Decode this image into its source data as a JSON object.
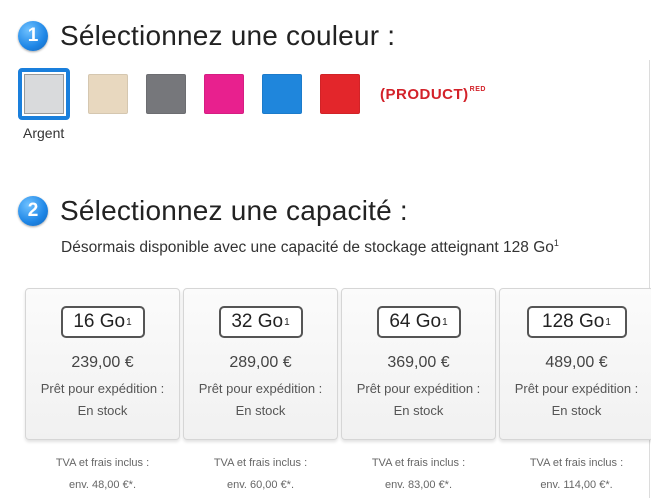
{
  "step1": {
    "number": "1",
    "title": "Sélectionnez une couleur :"
  },
  "colors": [
    {
      "name": "silver",
      "hex": "#d9dadc",
      "selected": true
    },
    {
      "name": "gold",
      "hex": "#e8d8bf",
      "selected": false
    },
    {
      "name": "space-gray",
      "hex": "#76777b",
      "selected": false
    },
    {
      "name": "pink",
      "hex": "#e8208e",
      "selected": false
    },
    {
      "name": "blue",
      "hex": "#1f86dc",
      "selected": false
    },
    {
      "name": "red",
      "hex": "#e3262b",
      "selected": false
    }
  ],
  "product_red": {
    "label": "(PRODUCT)",
    "sup": "RED"
  },
  "selected_color_label": "Argent",
  "step2": {
    "number": "2",
    "title": "Sélectionnez une capacité :"
  },
  "subtitle": {
    "text": "Désormais disponible avec une capacité de stockage atteignant 128 Go",
    "sup": "1"
  },
  "capacities": [
    {
      "label": "16 Go",
      "sup": "1",
      "price": "239,00 €",
      "ship": "Prêt pour expédition :",
      "stock": "En stock",
      "tax": "TVA et frais inclus :",
      "env": "env. 48,00 €*."
    },
    {
      "label": "32 Go",
      "sup": "1",
      "price": "289,00 €",
      "ship": "Prêt pour expédition :",
      "stock": "En stock",
      "tax": "TVA et frais inclus :",
      "env": "env. 60,00 €*."
    },
    {
      "label": "64 Go",
      "sup": "1",
      "price": "369,00 €",
      "ship": "Prêt pour expédition :",
      "stock": "En stock",
      "tax": "TVA et frais inclus :",
      "env": "env. 83,00 €*."
    },
    {
      "label": "128 Go",
      "sup": "1",
      "price": "489,00 €",
      "ship": "Prêt pour expédition :",
      "stock": "En stock",
      "tax": "TVA et frais inclus :",
      "env": "env. 114,00 €*."
    }
  ]
}
